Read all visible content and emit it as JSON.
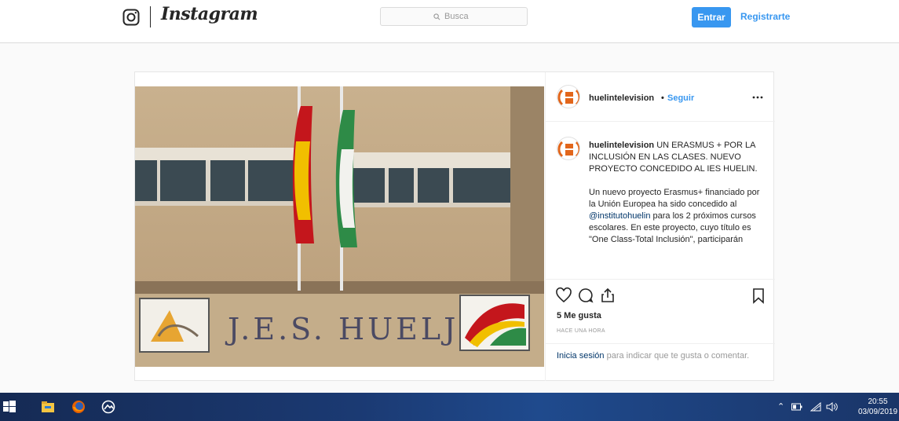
{
  "header": {
    "wordmark": "Instagram",
    "search_placeholder": "Busca",
    "login_button": "Entrar",
    "signup_link": "Registrarte"
  },
  "post": {
    "username": "huelintelevision",
    "separator": "•",
    "follow_label": "Seguir",
    "caption_title": "UN ERASMUS + POR LA INCLUSIÓN EN LAS CLASES. NUEVO PROYECTO CONCEDIDO AL IES HUELIN.",
    "caption_body_before": "Un nuevo proyecto Erasmus+ financiado por la Unión Europea ha sido concedido al ",
    "caption_mention": "@institutohuelin",
    "caption_body_after": " para los 2 próximos cursos escolares. En este proyecto, cuyo título es \"One Class-Total Inclusión\", participarán",
    "likes": "5 Me gusta",
    "time_ago": "HACE UNA HORA",
    "login_link": "Inicia sesión",
    "login_rest": " para indicar que te gusta o comentar.",
    "photo_sign_text": "J.E.S. HUELJN"
  },
  "taskbar": {
    "time": "20:55",
    "date": "03/09/2019",
    "items": [
      "start-icon",
      "file-explorer-icon",
      "firefox-icon",
      "photos-icon"
    ]
  },
  "colors": {
    "accent": "#3897f0",
    "mention": "#003569",
    "taskbar": "#1b3a73"
  }
}
